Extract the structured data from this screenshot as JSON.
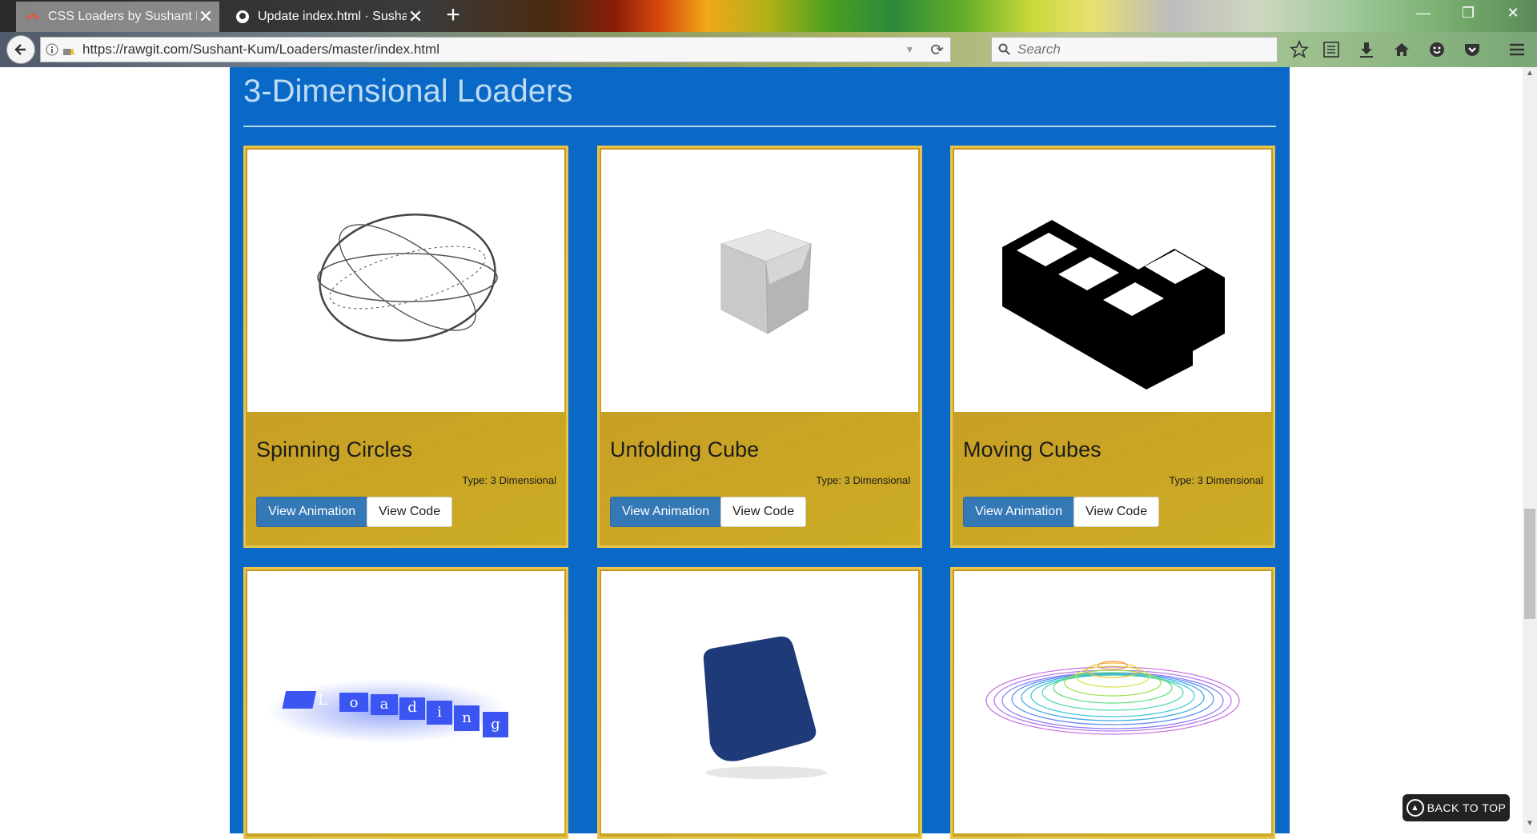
{
  "browser": {
    "tabs": [
      {
        "label": "CSS Loaders by Sushant K...",
        "icon": "rawgit-favicon",
        "active": true
      },
      {
        "label": "Update index.html · Susha...",
        "icon": "github-favicon",
        "active": false
      }
    ],
    "url": "https://rawgit.com/Sushant-Kum/Loaders/master/index.html",
    "search_placeholder": "Search",
    "new_tab_symbol": "+",
    "close_symbol": "✕",
    "window_controls": [
      "minimize",
      "restore",
      "close"
    ],
    "toolbar_icons": [
      "bookmark-star-icon",
      "reading-list-icon",
      "download-icon",
      "home-icon",
      "smiley-icon",
      "pocket-icon",
      "menu-icon"
    ]
  },
  "page": {
    "section_title": "3-Dimensional Loaders",
    "accent_color": "#0a69c7",
    "card_color": "#c8a025",
    "cards": [
      {
        "title": "Spinning Circles",
        "type": "Type: 3 Dimensional",
        "view_label": "View Animation",
        "code_label": "View Code",
        "preview": "wireframe-sphere"
      },
      {
        "title": "Unfolding Cube",
        "type": "Type: 3 Dimensional",
        "view_label": "View Animation",
        "code_label": "View Code",
        "preview": "grey-cube"
      },
      {
        "title": "Moving Cubes",
        "type": "Type: 3 Dimensional",
        "view_label": "View Animation",
        "code_label": "View Code",
        "preview": "black-isometric-cubes"
      },
      {
        "preview": "loading-letters",
        "letters": [
          "L",
          "o",
          "a",
          "d",
          "i",
          "n",
          "g"
        ]
      },
      {
        "preview": "navy-rounded-square"
      },
      {
        "preview": "rainbow-rings"
      }
    ],
    "back_to_top": "BACK TO TOP"
  }
}
